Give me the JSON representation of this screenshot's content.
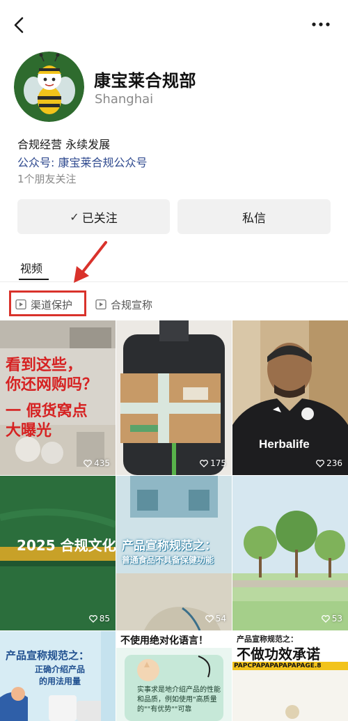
{
  "profile": {
    "name": "康宝莱合规部",
    "location": "Shanghai",
    "bio": "合规经营 永续发展",
    "account": "公众号: 康宝莱合规公众号",
    "friends": "1个朋友关注"
  },
  "actions": {
    "follow_label": "已关注",
    "message_label": "私信"
  },
  "tabs": {
    "video_label": "视频"
  },
  "collections": [
    {
      "label": "渠道保护"
    },
    {
      "label": "合规宣称"
    }
  ],
  "videos": [
    {
      "likes": "435",
      "overlay_lines": [
        "看到这些，",
        "你还网购吗？",
        "一 假货窝点",
        "大曝光"
      ]
    },
    {
      "likes": "175"
    },
    {
      "likes": "236",
      "shirt_text": "Herbalife"
    },
    {
      "likes": "85",
      "overlay_title": "2025 合规文化"
    },
    {
      "likes": "54",
      "overlay_title": "产品宣称规范之：",
      "overlay_subtitle": "普通食品不具备保健功能"
    },
    {
      "likes": "53"
    },
    {
      "overlay_title": "产品宣称规范之：",
      "overlay_subtitle": "正确介绍产品",
      "overlay_subtitle2": "的用法用量"
    },
    {
      "overlay_title": "不使用绝对化语言！",
      "overlay_body": "实事求是地介绍产品的性能和品质，例如使用\"高质量的\"\"有优势\"\"可靠"
    },
    {
      "overlay_title": "产品宣称规范之：",
      "overlay_subtitle": "不做功效承诺",
      "overlay_strip": "PAPCPAPAPAPAPAPAGE.8"
    }
  ],
  "colors": {
    "link": "#2f4a8f",
    "highlight": "#d9322b",
    "button_bg": "#f1f1f1",
    "muted": "#8a8a8a"
  }
}
